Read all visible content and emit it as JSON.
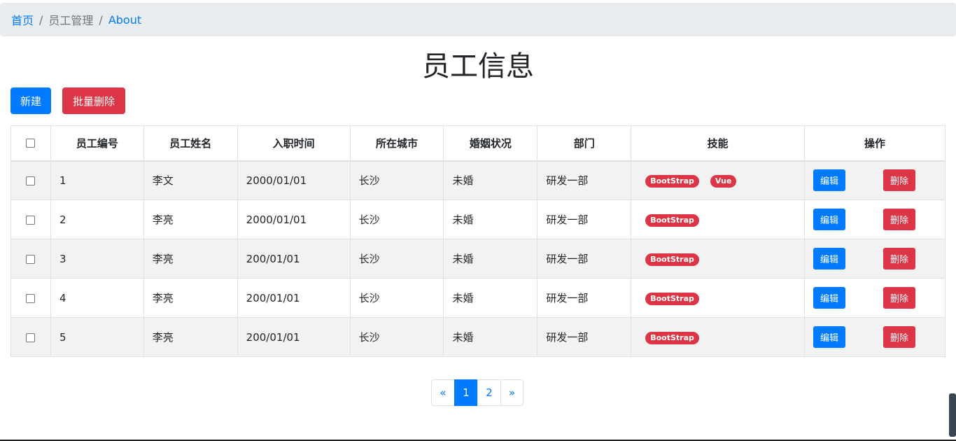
{
  "breadcrumb": {
    "items": [
      "首页",
      "员工管理",
      "About"
    ],
    "separator": "/"
  },
  "page": {
    "title": "员工信息"
  },
  "toolbar": {
    "new_label": "新建",
    "batch_delete_label": "批量删除"
  },
  "table": {
    "headers": [
      "员工编号",
      "员工姓名",
      "入职时间",
      "所在城市",
      "婚姻状况",
      "部门",
      "技能",
      "操作"
    ],
    "rows": [
      {
        "id": "1",
        "name": "李文",
        "hire_date": "2000/01/01",
        "city": "长沙",
        "marital": "未婚",
        "dept": "研发一部",
        "skills": [
          "BootStrap",
          "Vue"
        ]
      },
      {
        "id": "2",
        "name": "李亮",
        "hire_date": "2000/01/01",
        "city": "长沙",
        "marital": "未婚",
        "dept": "研发一部",
        "skills": [
          "BootStrap"
        ]
      },
      {
        "id": "3",
        "name": "李亮",
        "hire_date": "200/01/01",
        "city": "长沙",
        "marital": "未婚",
        "dept": "研发一部",
        "skills": [
          "BootStrap"
        ]
      },
      {
        "id": "4",
        "name": "李亮",
        "hire_date": "200/01/01",
        "city": "长沙",
        "marital": "未婚",
        "dept": "研发一部",
        "skills": [
          "BootStrap"
        ]
      },
      {
        "id": "5",
        "name": "李亮",
        "hire_date": "200/01/01",
        "city": "长沙",
        "marital": "未婚",
        "dept": "研发一部",
        "skills": [
          "BootStrap"
        ]
      }
    ],
    "edit_label": "编辑",
    "delete_label": "删除"
  },
  "pagination": {
    "prev": "«",
    "pages": [
      "1",
      "2"
    ],
    "next": "»",
    "active": "1"
  },
  "colors": {
    "primary": "#007bff",
    "danger": "#dc3545",
    "breadcrumb_bg": "#e9ecef"
  }
}
